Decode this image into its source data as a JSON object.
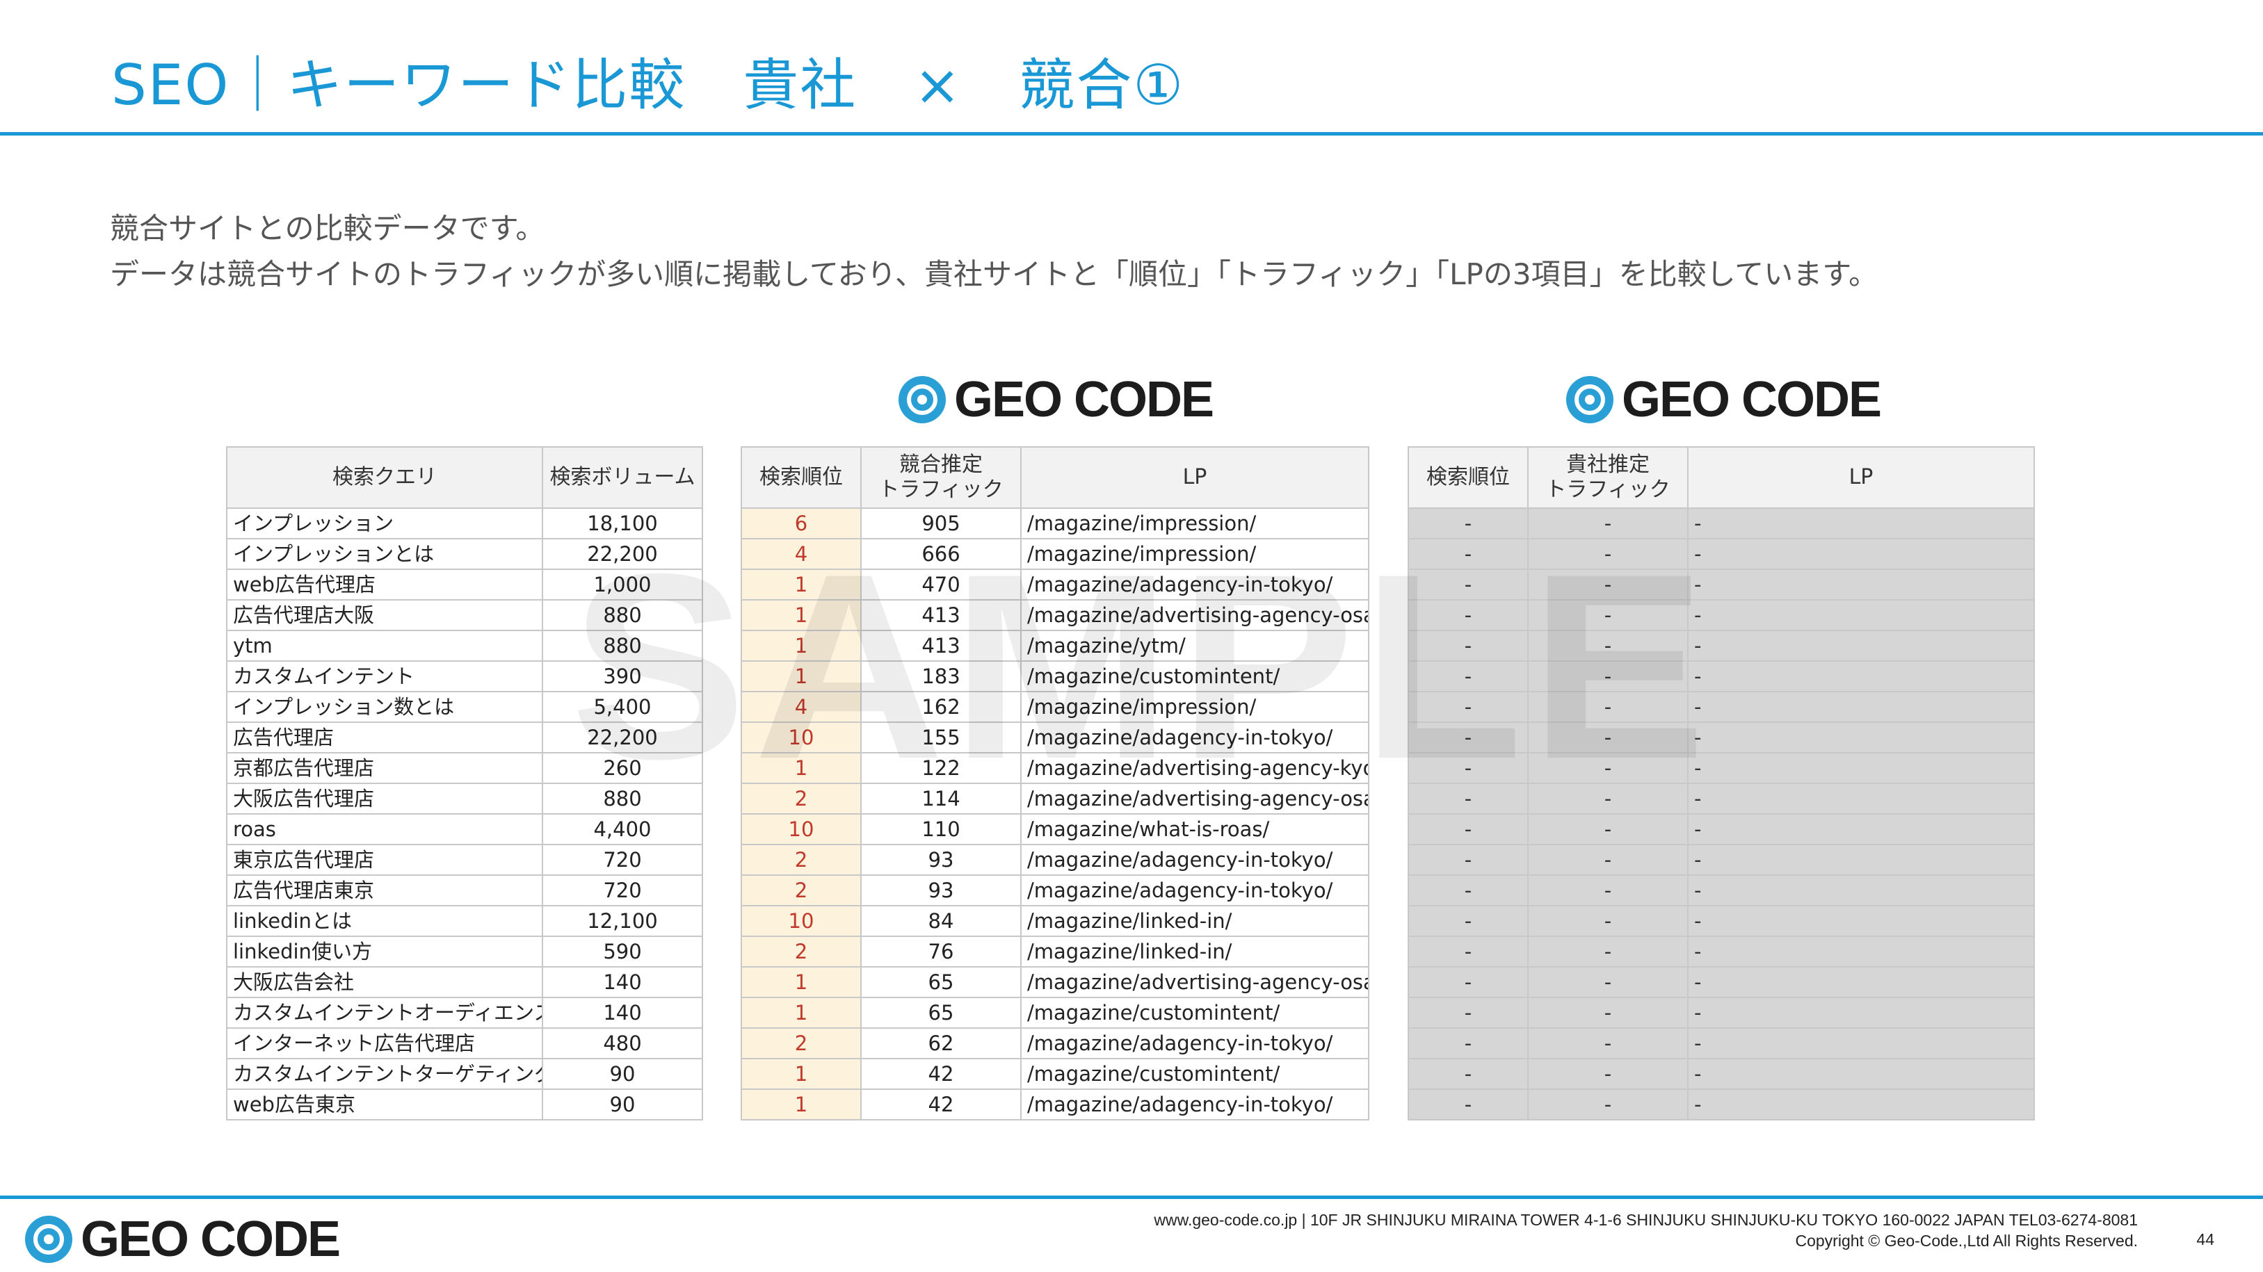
{
  "title": "SEO｜キーワード比較　貴社　×　競合①",
  "description": {
    "line1": "競合サイトとの比較データです。",
    "line2": "データは競合サイトのトラフィックが多い順に掲載しており、貴社サイトと「順位」「トラフィック」「LPの3項目」を比較しています。"
  },
  "logo_text": "GEO CODE",
  "watermark": "SAMPLE",
  "keyword_table": {
    "headers": [
      "検索クエリ",
      "検索ボリューム"
    ],
    "rows": [
      [
        "インプレッション",
        "18,100"
      ],
      [
        "インプレッションとは",
        "22,200"
      ],
      [
        "web広告代理店",
        "1,000"
      ],
      [
        "広告代理店大阪",
        "880"
      ],
      [
        "ytm",
        "880"
      ],
      [
        "カスタムインテント",
        "390"
      ],
      [
        "インプレッション数とは",
        "5,400"
      ],
      [
        "広告代理店",
        "22,200"
      ],
      [
        "京都広告代理店",
        "260"
      ],
      [
        "大阪広告代理店",
        "880"
      ],
      [
        "roas",
        "4,400"
      ],
      [
        "東京広告代理店",
        "720"
      ],
      [
        "広告代理店東京",
        "720"
      ],
      [
        "linkedinとは",
        "12,100"
      ],
      [
        "linkedin使い方",
        "590"
      ],
      [
        "大阪広告会社",
        "140"
      ],
      [
        "カスタムインテントオーディエンス",
        "140"
      ],
      [
        "インターネット広告代理店",
        "480"
      ],
      [
        "カスタムインテントターゲティング",
        "90"
      ],
      [
        "web広告東京",
        "90"
      ]
    ]
  },
  "competitor_table": {
    "headers": [
      "検索順位",
      "競合推定\nトラフィック",
      "LP"
    ],
    "rows": [
      [
        "6",
        "905",
        "/magazine/impression/"
      ],
      [
        "4",
        "666",
        "/magazine/impression/"
      ],
      [
        "1",
        "470",
        "/magazine/adagency-in-tokyo/"
      ],
      [
        "1",
        "413",
        "/magazine/advertising-agency-osaka/"
      ],
      [
        "1",
        "413",
        "/magazine/ytm/"
      ],
      [
        "1",
        "183",
        "/magazine/customintent/"
      ],
      [
        "4",
        "162",
        "/magazine/impression/"
      ],
      [
        "10",
        "155",
        "/magazine/adagency-in-tokyo/"
      ],
      [
        "1",
        "122",
        "/magazine/advertising-agency-kyoto/"
      ],
      [
        "2",
        "114",
        "/magazine/advertising-agency-osaka/"
      ],
      [
        "10",
        "110",
        "/magazine/what-is-roas/"
      ],
      [
        "2",
        "93",
        "/magazine/adagency-in-tokyo/"
      ],
      [
        "2",
        "93",
        "/magazine/adagency-in-tokyo/"
      ],
      [
        "10",
        "84",
        "/magazine/linked-in/"
      ],
      [
        "2",
        "76",
        "/magazine/linked-in/"
      ],
      [
        "1",
        "65",
        "/magazine/advertising-agency-osaka/"
      ],
      [
        "1",
        "65",
        "/magazine/customintent/"
      ],
      [
        "2",
        "62",
        "/magazine/adagency-in-tokyo/"
      ],
      [
        "1",
        "42",
        "/magazine/customintent/"
      ],
      [
        "1",
        "42",
        "/magazine/adagency-in-tokyo/"
      ]
    ]
  },
  "own_table": {
    "headers": [
      "検索順位",
      "貴社推定\nトラフィック",
      "LP"
    ],
    "placeholder": "-",
    "row_count": 20
  },
  "footer": {
    "address": "www.geo-code.co.jp  |  10F JR SHINJUKU MIRAINA TOWER 4-1-6 SHINJUKU SHINJUKU-KU TOKYO 160-0022  JAPAN  TEL03-6274-8081",
    "copyright": "Copyright © Geo-Code.,Ltd All Rights Reserved.",
    "page_number": "44"
  },
  "colors": {
    "accent": "#1a98d5",
    "rank_bg": "#fdf2dc",
    "rank_text": "#c0392b",
    "grey_cell": "#d6d6d6"
  }
}
